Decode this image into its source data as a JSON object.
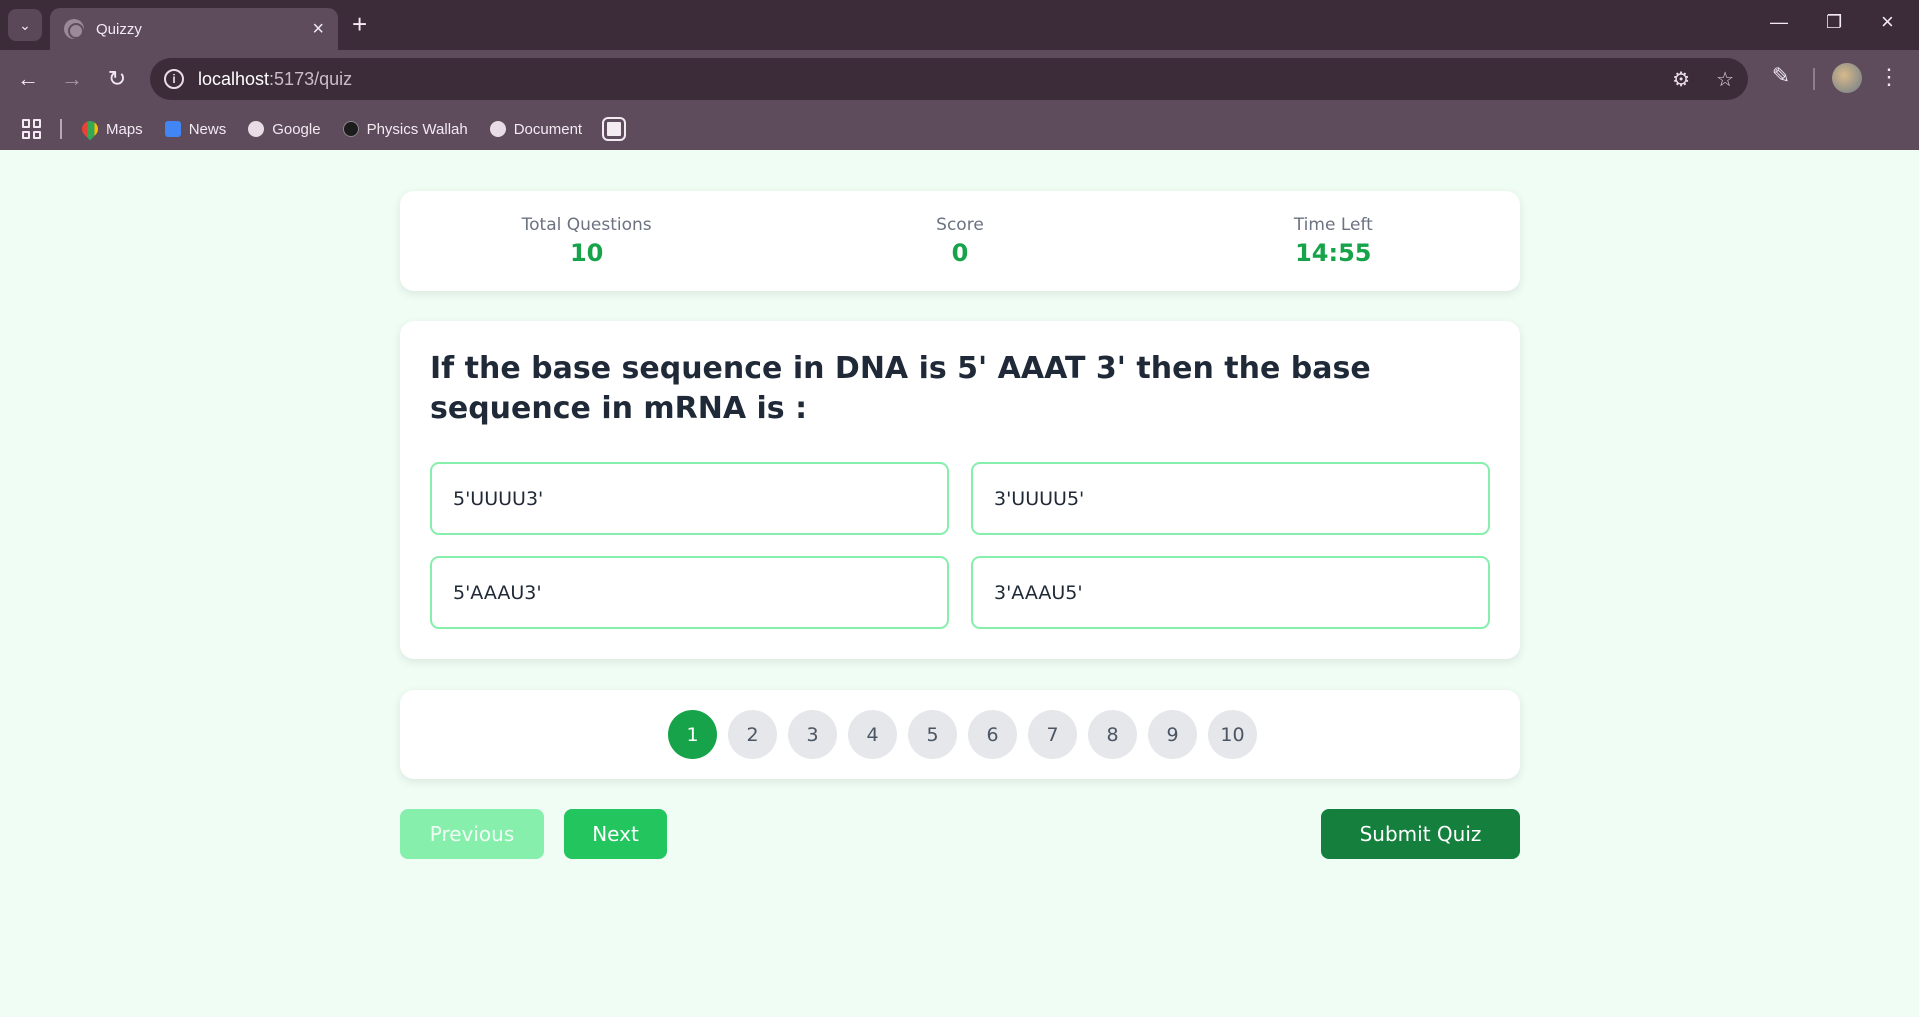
{
  "browser": {
    "tab_title": "Quizzy",
    "url_host": "localhost",
    "url_path": ":5173/quiz",
    "bookmarks": [
      "Maps",
      "News",
      "Google",
      "Physics Wallah",
      "Document"
    ]
  },
  "stats": {
    "total_questions_label": "Total Questions",
    "total_questions_value": "10",
    "score_label": "Score",
    "score_value": "0",
    "time_left_label": "Time Left",
    "time_left_value": "14:55"
  },
  "question": {
    "text": "If the base sequence in DNA is 5' AAAT 3' then the base sequence in mRNA is :",
    "options": [
      "5'UUUU3'",
      "3'UUUU5'",
      "5'AAAU3'",
      "3'AAAU5'"
    ]
  },
  "pager": {
    "pages": [
      "1",
      "2",
      "3",
      "4",
      "5",
      "6",
      "7",
      "8",
      "9",
      "10"
    ],
    "current": "1"
  },
  "actions": {
    "previous_label": "Previous",
    "next_label": "Next",
    "submit_label": "Submit Quiz"
  },
  "colors": {
    "accent": "#16a34a",
    "option_border": "#86efac",
    "submit": "#15803d",
    "page_bg": "#f0fdf4"
  }
}
